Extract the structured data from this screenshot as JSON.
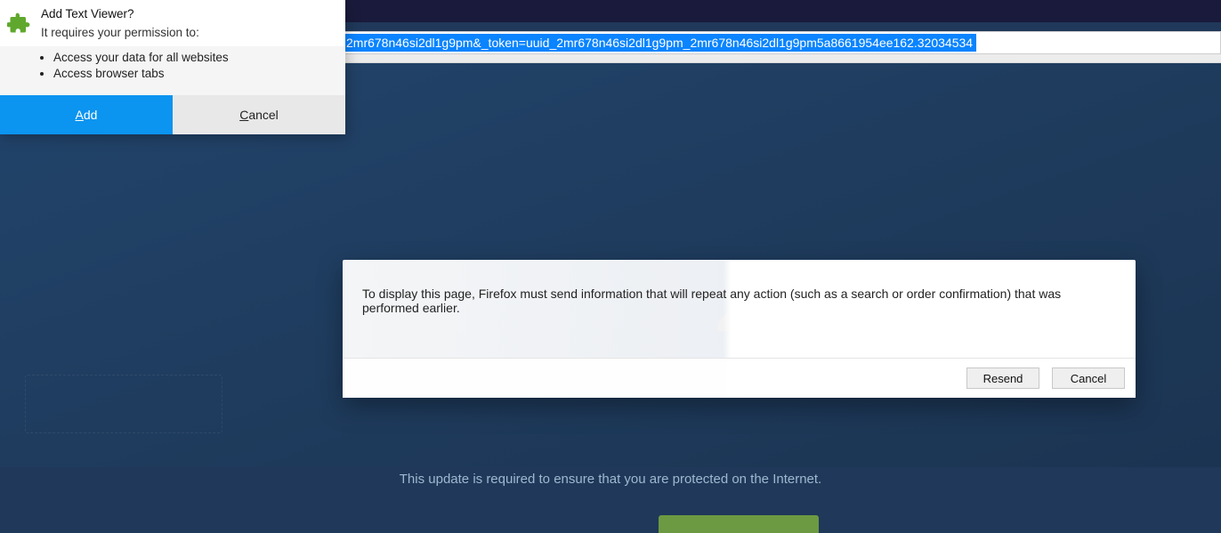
{
  "chrome": {
    "url_selected_fragment": "2mr678n46si2dl1g9pm&_token=uuid_2mr678n46si2dl1g9pm_2mr678n46si2dl1g9pm5a8661954ee162.32034534"
  },
  "extension_prompt": {
    "title": "Add Text Viewer?",
    "subtitle": "It requires your permission to:",
    "permissions": [
      "Access your data for all websites",
      "Access browser tabs"
    ],
    "primary_button": {
      "prefix": "A",
      "rest": "dd"
    },
    "secondary_button": {
      "prefix": "C",
      "rest": "ancel"
    }
  },
  "resend_dialog": {
    "message": "To display this page, Firefox must send information that will repeat any action (such as a search or order confirmation) that was performed earlier.",
    "resend_label": "Resend",
    "cancel_label": "Cancel"
  },
  "page": {
    "subtext": "This update is required to ensure that you are protected on the Internet."
  }
}
